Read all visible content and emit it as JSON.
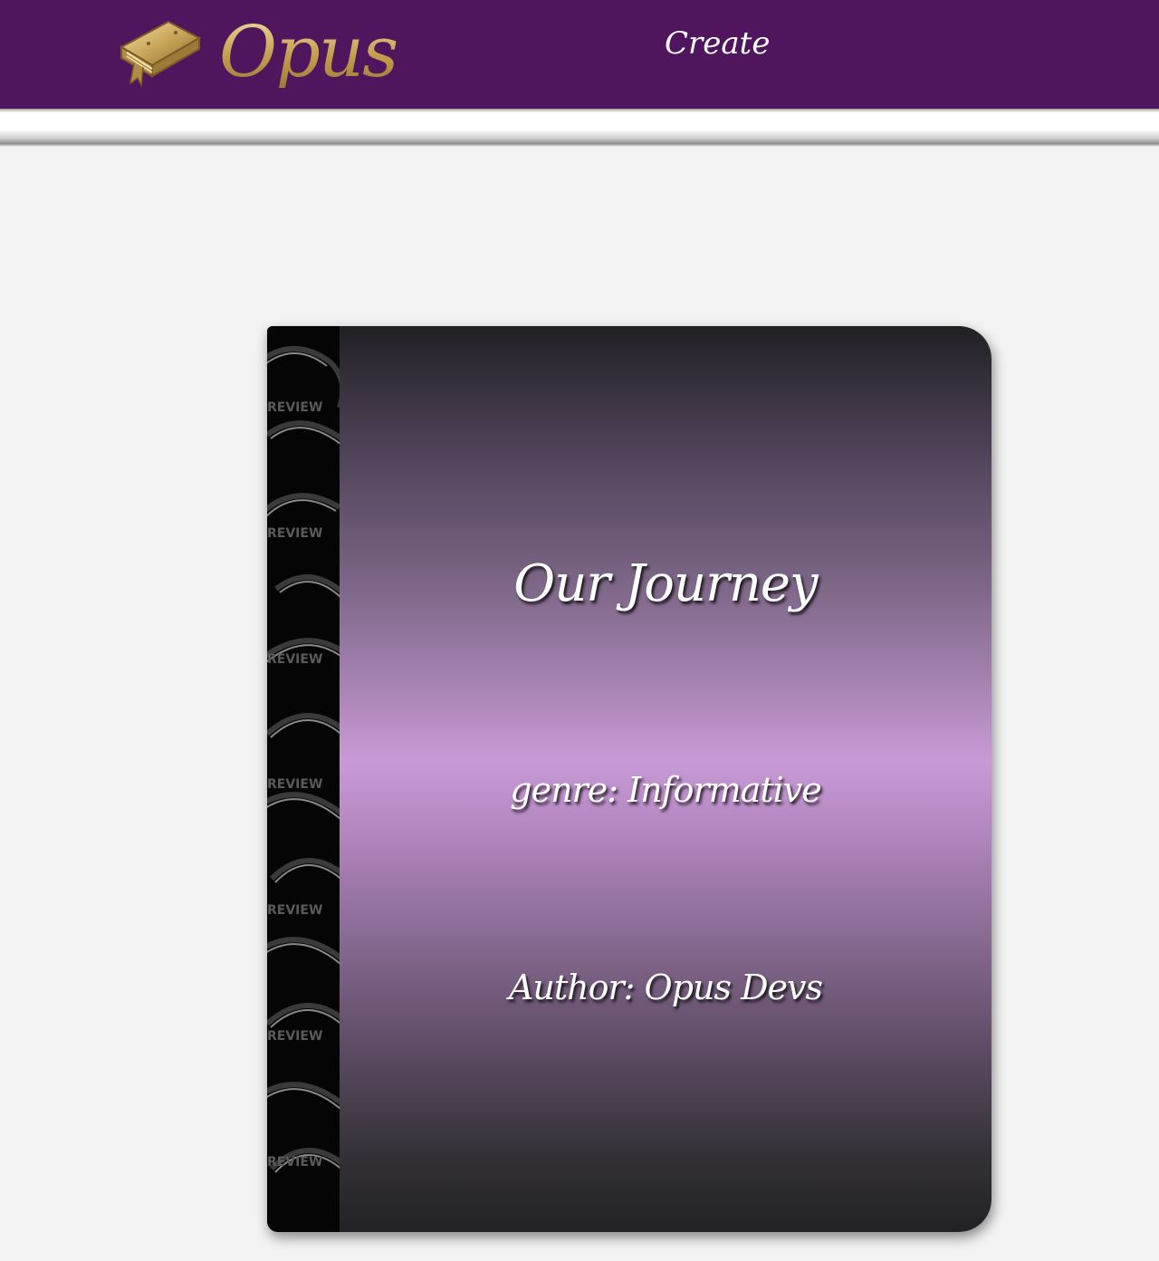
{
  "navbar": {
    "logo_text": "Opus",
    "create_label": "Create"
  },
  "book": {
    "title": "Our Journey",
    "genre": "genre: Informative",
    "author": "Author: Opus Devs",
    "spine_watermark": "REVIEW"
  },
  "colors": {
    "navbar": "#4f155d",
    "background": "#f3f3f3",
    "cover_highlight": "#c89ad6",
    "cover_dark": "#202023",
    "logo_gold": "#c9a65a"
  }
}
